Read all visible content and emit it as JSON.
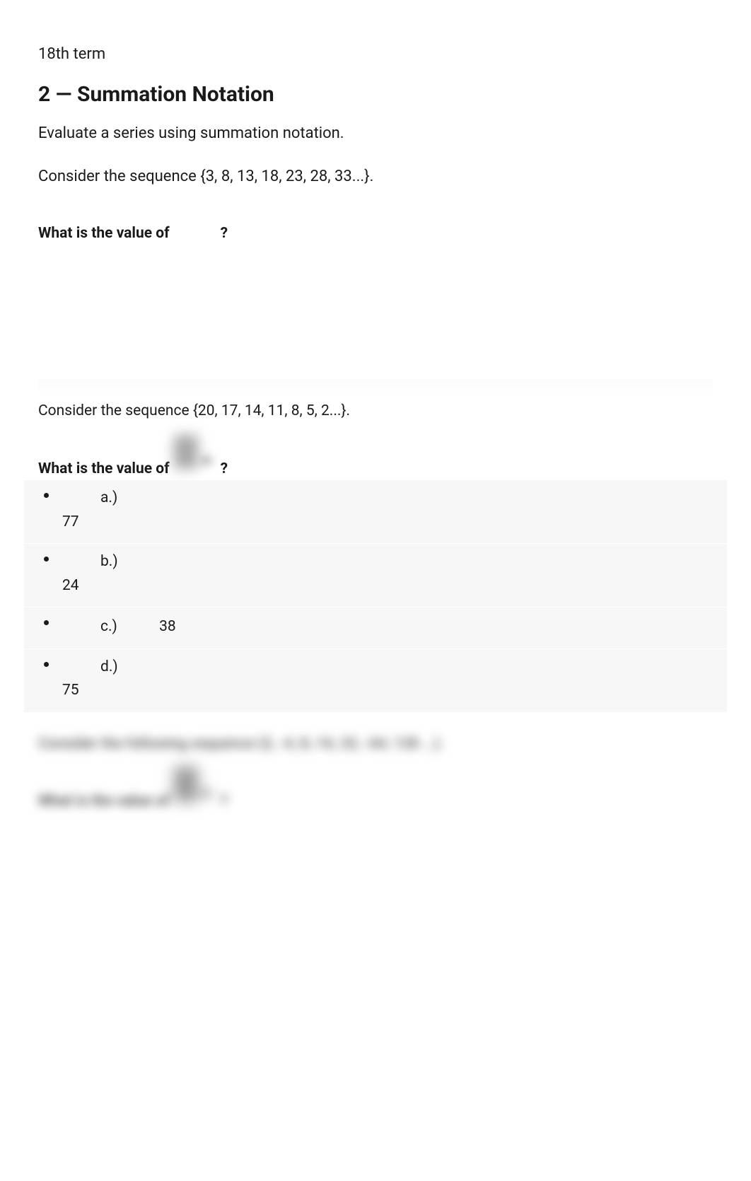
{
  "top_text": "18th term",
  "section": {
    "heading": "2 — Summation Notation",
    "description": "Evaluate a series using summation notation."
  },
  "q1": {
    "sequence": "Consider the sequence {3, 8, 13, 18, 23, 28, 33...}.",
    "question_prefix": "What is the value of",
    "question_suffix": "?"
  },
  "q2": {
    "sequence": "Consider the sequence {20, 17, 14, 11, 8, 5, 2...}.",
    "question_prefix": "What is the value of",
    "question_suffix": "?",
    "answers": [
      {
        "label": "a.)",
        "value": "77",
        "highlighted": false
      },
      {
        "label": "b.)",
        "value": "24",
        "highlighted": false
      },
      {
        "label": "c.)",
        "value": "38",
        "highlighted": true
      },
      {
        "label": "d.)",
        "value": "75",
        "highlighted": false
      }
    ]
  },
  "q3": {
    "sequence": "Consider the following sequence {2, -4, 8,-16, 32, -64, 128 ...}.",
    "question_prefix": "What is the value of",
    "question_suffix": "?"
  }
}
